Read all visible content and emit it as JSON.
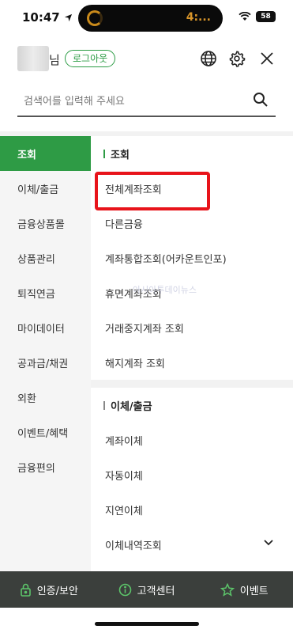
{
  "status_bar": {
    "time": "10:47",
    "island_text": "4:...",
    "battery": "58"
  },
  "header": {
    "user_suffix": "님",
    "logout_label": "로그아웃",
    "icons": [
      "globe-icon",
      "gear-icon",
      "close-icon"
    ]
  },
  "search": {
    "placeholder": "검색어를 입력해 주세요"
  },
  "left_nav": {
    "items": [
      {
        "label": "조회"
      },
      {
        "label": "이체/출금"
      },
      {
        "label": "금융상품몰"
      },
      {
        "label": "상품관리"
      },
      {
        "label": "퇴직연금"
      },
      {
        "label": "마이데이터"
      },
      {
        "label": "공과금/채권"
      },
      {
        "label": "외환"
      },
      {
        "label": "이벤트/혜택"
      },
      {
        "label": "금융편의"
      }
    ],
    "active_index": 0
  },
  "content": {
    "sections": [
      {
        "title": "조회",
        "items": [
          {
            "label": "전체계좌조회"
          },
          {
            "label": "다른금융"
          },
          {
            "label": "계좌통합조회(어카운트인포)"
          },
          {
            "label": "휴면계좌조회"
          },
          {
            "label": "거래중지계좌 조회"
          },
          {
            "label": "해지계좌 조회"
          }
        ]
      },
      {
        "title": "이체/출금",
        "items": [
          {
            "label": "계좌이체"
          },
          {
            "label": "자동이체"
          },
          {
            "label": "지연이체"
          },
          {
            "label": "이체내역조회"
          }
        ]
      }
    ],
    "watermark": "아시아투데이뉴스"
  },
  "bottom_bar": {
    "items": [
      {
        "label": "인증/보안",
        "icon": "lock-icon"
      },
      {
        "label": "고객센터",
        "icon": "info-icon"
      },
      {
        "label": "이벤트",
        "icon": "star-icon"
      }
    ]
  },
  "colors": {
    "brand_green": "#2e9b45",
    "highlight_red": "#e8131a",
    "bottom_bar_bg": "#3b3f3c"
  }
}
